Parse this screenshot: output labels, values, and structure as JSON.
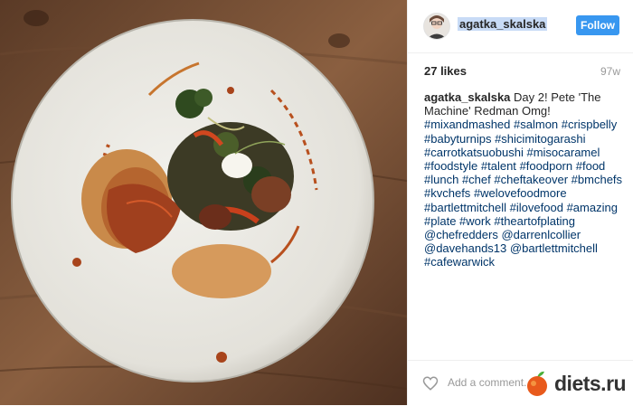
{
  "post": {
    "username": "agatka_skalska",
    "follow_label": "Follow",
    "likes": "27 likes",
    "age": "97w",
    "caption_user": "agatka_skalska",
    "caption_text": "Day 2! Pete 'The Machine' Redman Omg!",
    "hashtags": [
      "#mixandmashed",
      "#salmon",
      "#crispbelly",
      "#babyturnips",
      "#shicimitogarashi",
      "#carrotkatsuobushi",
      "#misocaramel",
      "#foodstyle",
      "#talent",
      "#foodporn",
      "#food",
      "#lunch",
      "#chef",
      "#cheftakeover",
      "#bmchefs",
      "#kvchefs",
      "#welovefoodmore",
      "#bartlettmitchell",
      "#ilovefood",
      "#amazing",
      "#plate",
      "#work",
      "#theartofplating"
    ],
    "mentions": [
      "@chefredders",
      "@darrenlcollier",
      "@davehands13",
      "@bartlettmitchell"
    ],
    "last_tag": "#cafewarwick",
    "comment_placeholder": "Add a comment..."
  },
  "watermark": {
    "text": "diets.ru"
  },
  "icons": {
    "like": "heart-icon",
    "watermark": "apple-icon"
  },
  "colors": {
    "follow": "#3897f0",
    "tag": "#003569",
    "highlight": "#c8dbf6"
  }
}
